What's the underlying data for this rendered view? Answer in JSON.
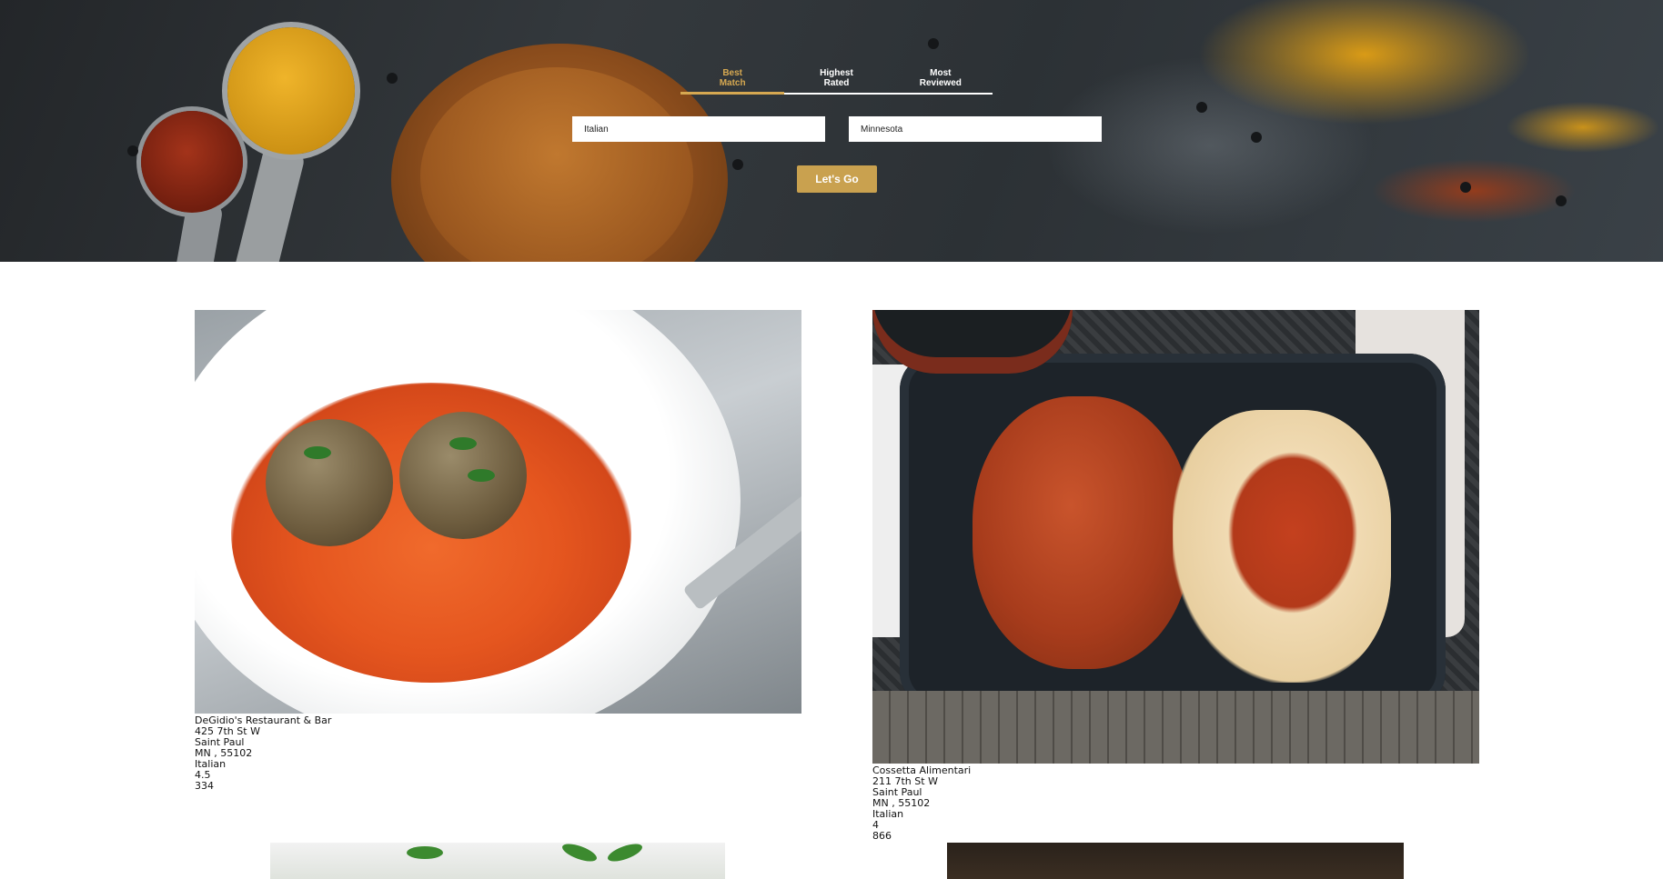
{
  "search": {
    "tabs": [
      {
        "label": "Best\nMatch",
        "active": true
      },
      {
        "label": "Highest\nRated",
        "active": false
      },
      {
        "label": "Most\nReviewed",
        "active": false
      }
    ],
    "term_value": "Italian",
    "location_value": "Minnesota",
    "submit_label": "Let's Go"
  },
  "colors": {
    "accent": "#c9a14f",
    "active_tab": "#d6a851"
  },
  "results": [
    {
      "name": "DeGidio's Restaurant & Bar",
      "address": "425 7th St W",
      "city": "Saint Paul",
      "state_zip": "MN , 55102",
      "category": "Italian",
      "rating": "4.5",
      "review_count": "334",
      "image": "pasta-meatballs-photo"
    },
    {
      "name": "Cossetta Alimentari",
      "address": "211 7th St W",
      "city": "Saint Paul",
      "state_zip": "MN , 55102",
      "category": "Italian",
      "rating": "4",
      "review_count": "866",
      "image": "chicken-parm-takeout-photo"
    }
  ]
}
